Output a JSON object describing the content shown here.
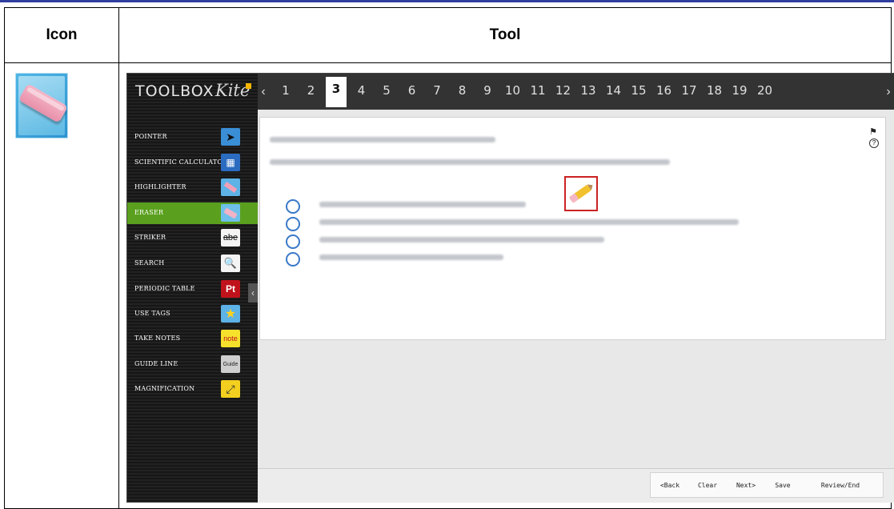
{
  "table": {
    "col_icon": "Icon",
    "col_tool": "Tool"
  },
  "toolbox": {
    "title": "TOOLBOX",
    "logo": "Kite"
  },
  "tools": [
    {
      "label": "POINTER",
      "icon": "pointer-icon"
    },
    {
      "label": "SCIENTIFIC CALCULATOR",
      "icon": "calculator-icon"
    },
    {
      "label": "HIGHLIGHTER",
      "icon": "highlighter-icon"
    },
    {
      "label": "ERASER",
      "icon": "eraser-icon",
      "active": true
    },
    {
      "label": "STRIKER",
      "icon": "striker-icon",
      "text": "abe"
    },
    {
      "label": "SEARCH",
      "icon": "search-icon"
    },
    {
      "label": "PERIODIC TABLE",
      "icon": "periodic-table-icon",
      "text": "Pt"
    },
    {
      "label": "USE TAGS",
      "icon": "star-icon"
    },
    {
      "label": "TAKE NOTES",
      "icon": "note-icon",
      "text": "note"
    },
    {
      "label": "GUIDE LINE",
      "icon": "guide-icon",
      "text": "Guide"
    },
    {
      "label": "MAGNIFICATION",
      "icon": "magnification-icon"
    }
  ],
  "questions": [
    "1",
    "2",
    "3",
    "4",
    "5",
    "6",
    "7",
    "8",
    "9",
    "10",
    "11",
    "12",
    "13",
    "14",
    "15",
    "16",
    "17",
    "18",
    "19",
    "20"
  ],
  "current_question": "3",
  "footer": {
    "back": "<Back",
    "clear": "Clear",
    "next": "Next>",
    "save": "Save",
    "review": "Review/End"
  },
  "colors": {
    "active_tool": "#5aa01e",
    "radio": "#3a79c8",
    "highlight_box": "#cc2222"
  }
}
